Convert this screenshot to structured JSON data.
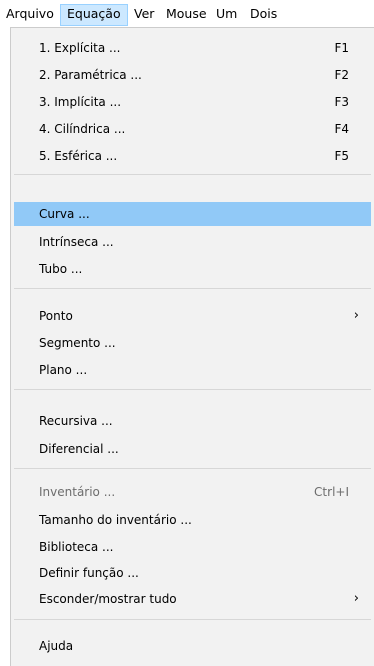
{
  "menubar": {
    "items": [
      {
        "label": "Arquivo"
      },
      {
        "label": "Equação"
      },
      {
        "label": "Ver"
      },
      {
        "label": "Mouse"
      },
      {
        "label": "Um"
      },
      {
        "label": "Dois"
      }
    ],
    "active_item": "Equação"
  },
  "menu": {
    "groups": [
      {
        "items": [
          {
            "label": "1. Explícita ...",
            "shortcut": "F1"
          },
          {
            "label": "2. Paramétrica ...",
            "shortcut": "F2"
          },
          {
            "label": "3. Implícita ...",
            "shortcut": "F3"
          },
          {
            "label": "4. Cilíndrica ...",
            "shortcut": "F4"
          },
          {
            "label": "5. Esférica ...",
            "shortcut": "F5"
          }
        ]
      },
      {
        "items": [
          {
            "label": "Curva ...",
            "highlighted": true
          },
          {
            "label": "Intrínseca ..."
          },
          {
            "label": "Tubo ..."
          }
        ]
      },
      {
        "items": [
          {
            "label": "Ponto",
            "submenu_arrow": "›"
          },
          {
            "label": "Segmento ..."
          },
          {
            "label": "Plano ..."
          }
        ]
      },
      {
        "items": [
          {
            "label": "Recursiva ..."
          },
          {
            "label": "Diferencial ..."
          }
        ]
      },
      {
        "items": [
          {
            "label": "Inventário ...",
            "shortcut": "Ctrl+I",
            "disabled": true
          },
          {
            "label": "Tamanho do inventário ..."
          },
          {
            "label": "Biblioteca ..."
          },
          {
            "label": "Definir função ..."
          },
          {
            "label": "Esconder/mostrar tudo",
            "submenu_arrow": "›"
          }
        ]
      },
      {
        "items": [
          {
            "label": "Ajuda"
          }
        ]
      }
    ]
  },
  "colors": {
    "menubar_active_bg": "#cce8ff",
    "menu_bg": "#f2f2f2",
    "highlight_bg": "#91c9f7",
    "disabled_text": "#6d6d6d",
    "separator": "#d7d7d7"
  }
}
